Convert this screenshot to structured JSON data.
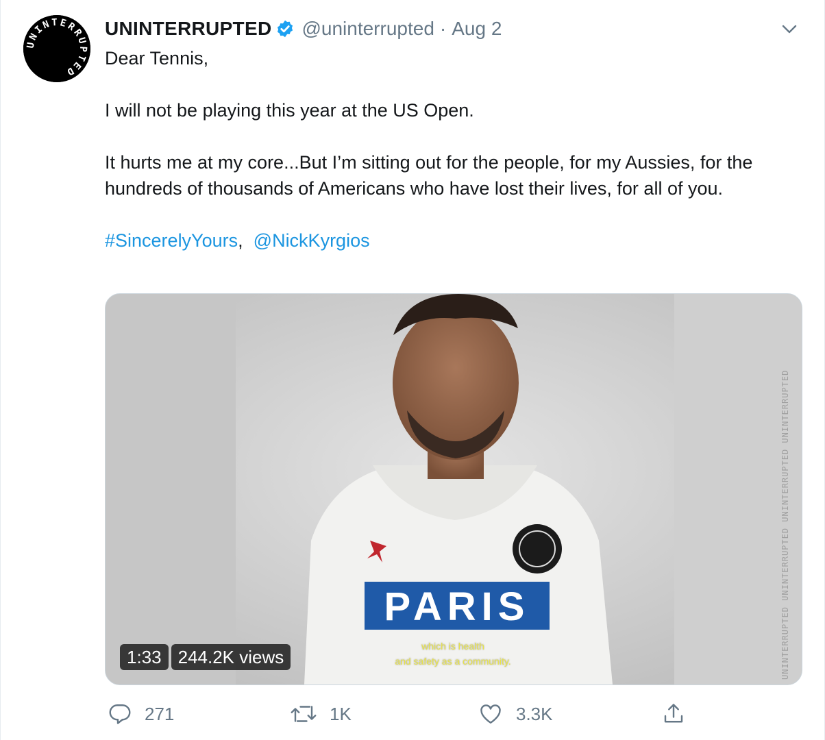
{
  "author": {
    "display_name": "UNINTERRUPTED",
    "handle": "@uninterrupted",
    "separator": "·",
    "date": "Aug 2",
    "avatar_text": "UNINTERRUPTED",
    "verified_icon": "verified-check-icon"
  },
  "tweet": {
    "line1": "Dear Tennis,",
    "line2": "I will not be playing this year at the US Open.",
    "line3": "It hurts me at my core...But I’m sitting out for the people, for my Aussies, for the hundreds of thousands of Americans who have lost their lives, for all of you.",
    "hashtag": "#SincerelyYours",
    "comma": ",",
    "mention": "@NickKyrgios"
  },
  "media": {
    "duration": "1:33",
    "views": "244.2K views",
    "hoodie_text": "PARIS",
    "subtitle_line1": "which is health",
    "subtitle_line2": "and safety as a community.",
    "watermark": "UNINTERRUPTED UNINTERRUPTED UNINTERRUPTED UNINTERRUPTED"
  },
  "actions": {
    "reply_count": "271",
    "retweet_count": "1K",
    "like_count": "3.3K"
  },
  "colors": {
    "link": "#1b95e0",
    "muted": "#657786",
    "verified": "#1da1f2"
  }
}
